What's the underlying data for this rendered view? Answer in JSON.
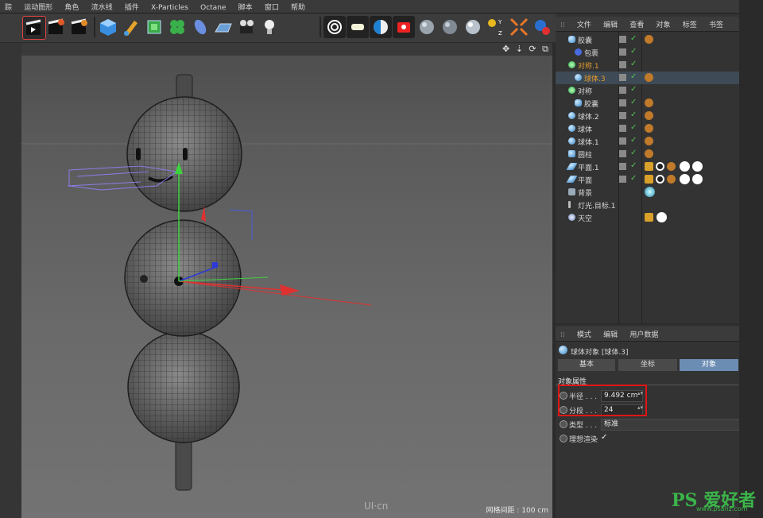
{
  "menubar": {
    "items": [
      "踪",
      "运动图形",
      "角色",
      "流水线",
      "插件",
      "X-Particles",
      "Octane",
      "脚本",
      "窗口",
      "帮助"
    ]
  },
  "object_manager": {
    "menu": [
      "文件",
      "编辑",
      "查看",
      "对象",
      "标签",
      "书签"
    ],
    "rows": [
      {
        "name": "胶囊",
        "highlight": false
      },
      {
        "name": "包裹",
        "highlight": false
      },
      {
        "name": "对称.1",
        "highlight": true
      },
      {
        "name": "球体.3",
        "highlight": true
      },
      {
        "name": "对称",
        "highlight": false
      },
      {
        "name": "胶囊",
        "highlight": false
      },
      {
        "name": "球体.2",
        "highlight": false
      },
      {
        "name": "球体",
        "highlight": false
      },
      {
        "name": "球体.1",
        "highlight": false
      },
      {
        "name": "圆柱",
        "highlight": false
      },
      {
        "name": "平面.1",
        "highlight": false
      },
      {
        "name": "平面",
        "highlight": false
      },
      {
        "name": "背景",
        "highlight": false
      },
      {
        "name": "灯光.目标.1",
        "highlight": false
      },
      {
        "name": "天空",
        "highlight": false
      }
    ]
  },
  "attribute_manager": {
    "menu": [
      "模式",
      "编辑",
      "用户数据"
    ],
    "title": "球体对象 [球体.3]",
    "tabs": [
      "基本",
      "坐标",
      "对象"
    ],
    "active_tab": "对象",
    "section": "对象属性",
    "properties": [
      {
        "label": "半径 . . .",
        "value": "9.492 cm"
      },
      {
        "label": "分段 . . .",
        "value": "24"
      },
      {
        "label": "类型 . . .",
        "value": "标准"
      },
      {
        "label": "理想渲染",
        "value": "✓"
      }
    ]
  },
  "viewport": {
    "grid_status": "网格间距 : 100 cm",
    "watermark": "UI·cn",
    "nav_icons": "✥ ⇣ ⟳ ⧉"
  },
  "site_watermark": {
    "logo": "PS 爱好者",
    "url": "www.psahz.com"
  },
  "colors": {
    "accent_tab": "#6c8db3",
    "highlight_box": "#e01515",
    "orange_text": "#e49a2d",
    "check_green": "#4fc44f"
  }
}
